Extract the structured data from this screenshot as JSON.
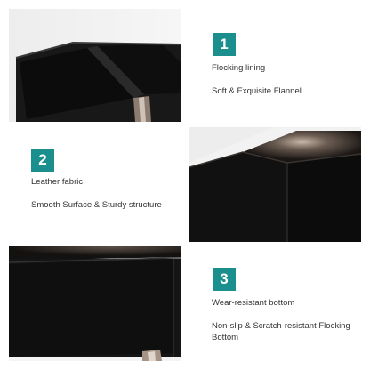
{
  "features": [
    {
      "number": "1",
      "title": "Flocking lining",
      "description": "Soft & Exquisite Flannel",
      "image": "box-top-compartments-photo"
    },
    {
      "number": "2",
      "title": "Leather fabric",
      "description": "Smooth Surface & Sturdy structure",
      "image": "leather-corner-photo"
    },
    {
      "number": "3",
      "title": "Wear-resistant bottom",
      "description": "Non-slip & Scratch-resistant Flocking Bottom",
      "image": "box-bottom-photo"
    }
  ],
  "colors": {
    "badge": "#1b8f8d",
    "box": "#141414",
    "background": "#ffffff"
  }
}
